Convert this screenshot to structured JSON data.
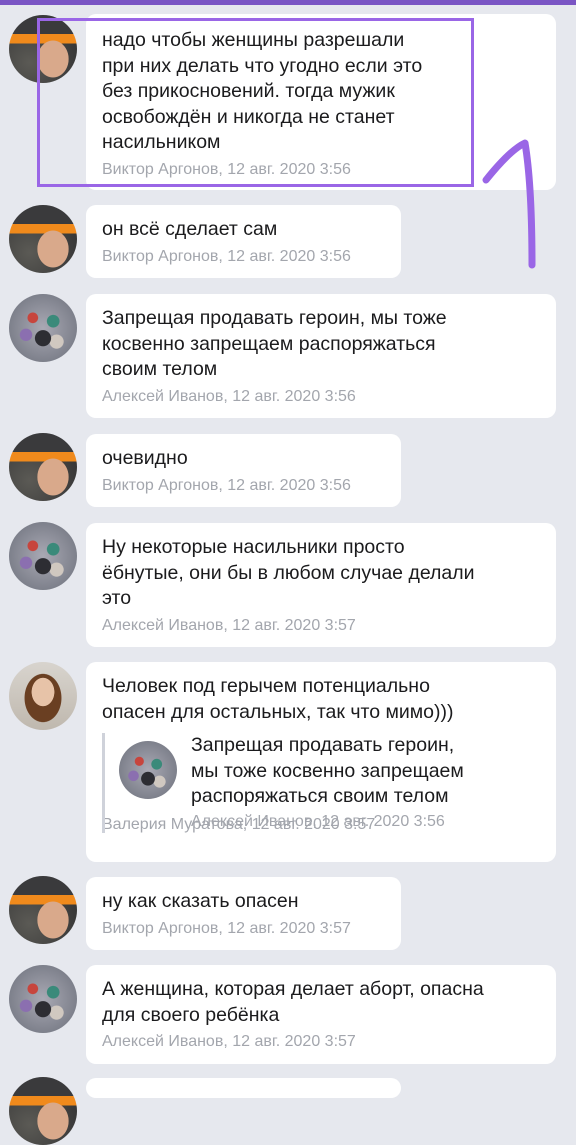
{
  "messages": [
    {
      "author": "Виктор Аргонов",
      "time": "12 авг. 2020 3:56",
      "text": "надо чтобы женщины разрешали\nпри них делать что угодно если это\nбез прикосновений. тогда мужик\nосвобождён и никогда не станет\nнасильником"
    },
    {
      "author": "Виктор Аргонов",
      "time": "12 авг. 2020 3:56",
      "text": "он всё сделает сам"
    },
    {
      "author": "Алексей Иванов",
      "time": "12 авг. 2020 3:56",
      "text": "Запрещая продавать героин, мы тоже\nкосвенно запрещаем распоряжаться\nсвоим телом"
    },
    {
      "author": "Виктор Аргонов",
      "time": "12 авг. 2020 3:56",
      "text": "очевидно"
    },
    {
      "author": "Алексей Иванов",
      "time": "12 авг. 2020 3:57",
      "text": "Ну некоторые насильники просто\nёбнутые, они бы в любом случае делали\nэто"
    },
    {
      "author": "Валерия Муратова",
      "time": "12 авг. 2020 3:57",
      "text": "Человек под герычем потенциально\nопасен для остальных, так что мимо)))",
      "quote": {
        "author": "Алексей Иванов",
        "time": "12 авг. 2020 3:56",
        "text": "Запрещая продавать героин,\nмы тоже косвенно запрещаем\nраспоряжаться своим телом"
      }
    },
    {
      "author": "Виктор Аргонов",
      "time": "12 авг. 2020 3:57",
      "text": "ну как сказать опасен"
    },
    {
      "author": "Алексей Иванов",
      "time": "12 авг. 2020 3:57",
      "text": "А женщина, которая делает аборт, опасна\nдля своего ребёнка"
    }
  ],
  "colors": {
    "accent": "#7a55c4",
    "annotation": "#9a66e6"
  }
}
